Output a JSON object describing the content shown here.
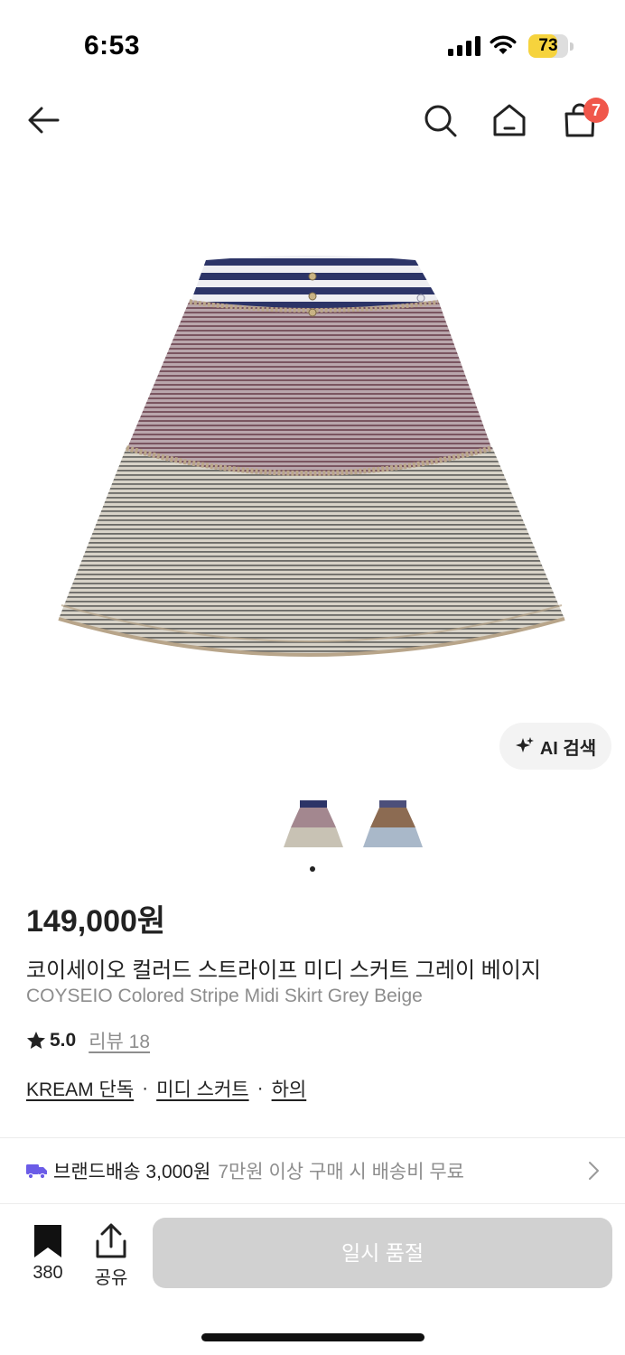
{
  "status_bar": {
    "time": "6:53",
    "battery_level": "73",
    "battery_fraction": 0.73,
    "battery_color": "#f6d33d",
    "icons": [
      "cellular-signal-icon",
      "wifi-icon",
      "battery-icon"
    ]
  },
  "header": {
    "icons": [
      "back-arrow-icon",
      "search-icon",
      "home-icon",
      "shopping-bag-icon"
    ],
    "cart_count": "7",
    "badge_color": "#f0574b"
  },
  "gallery": {
    "ai_search_label": "AI 검색",
    "thumbnail_count": 2,
    "active_index": 0
  },
  "product": {
    "price": "149,000원",
    "name_ko": "코이세이오 컬러드 스트라이프 미디 스커트 그레이 베이지",
    "name_en": "COYSEIO Colored Stripe Midi Skirt Grey Beige",
    "rating": "5.0",
    "review_label": "리뷰 18",
    "tags": [
      "KREAM 단독",
      "미디 스커트",
      "하의"
    ],
    "separator": "·"
  },
  "delivery": {
    "label": "브랜드배송 3,000원",
    "note": "7만원 이상 구매 시 배송비 무료",
    "icon_color": "#6b5ce7"
  },
  "bottom_bar": {
    "bookmark_count": "380",
    "share_label": "공유",
    "cta_label": "일시 품절"
  }
}
